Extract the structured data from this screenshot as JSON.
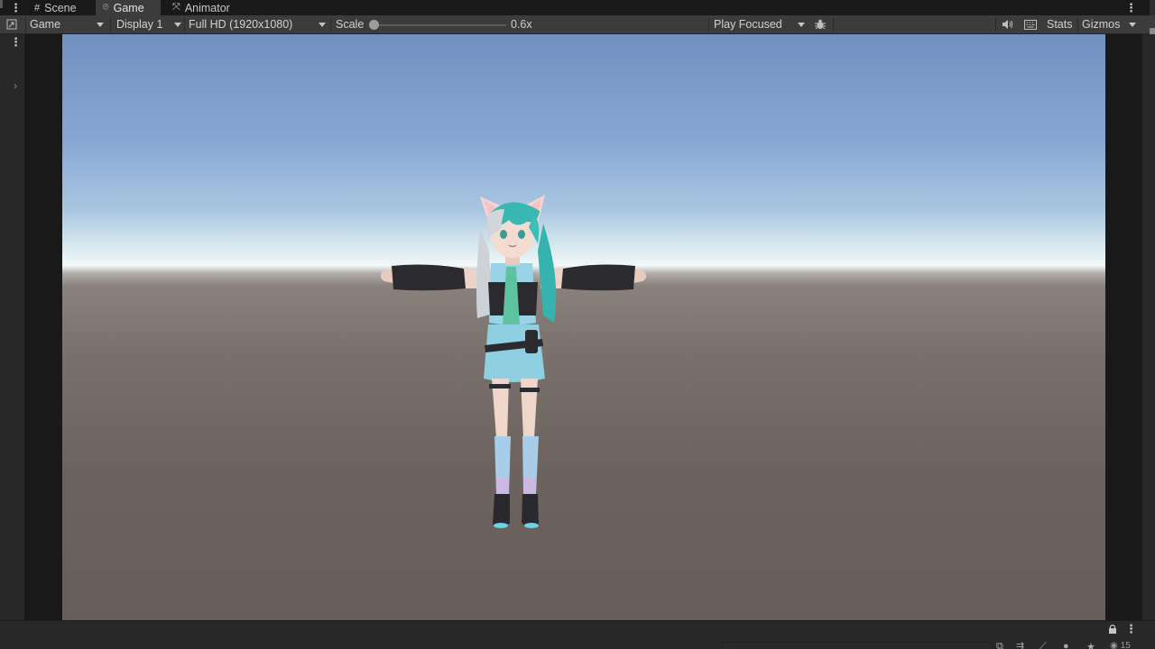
{
  "tabs": [
    {
      "label": "Scene",
      "icon": "scene-grid-icon",
      "glyph": "#"
    },
    {
      "label": "Game",
      "icon": "gamepad-icon",
      "glyph": "⌾"
    },
    {
      "label": "Animator",
      "icon": "animator-icon",
      "glyph": "⤧"
    }
  ],
  "toolbar": {
    "view_mode": "Game",
    "display": "Display 1",
    "resolution": "Full HD (1920x1080)",
    "scale_label": "Scale",
    "scale_value": "0.6x",
    "play_mode": "Play Focused",
    "stats": "Stats",
    "gizmos": "Gizmos"
  },
  "bottom": {
    "visibility_count": "15"
  },
  "colors": {
    "panel": "#3c3c3c",
    "background": "#191919",
    "sky_top": "#7090c0",
    "horizon": "#f2f7f7",
    "ground": "#6c625e"
  }
}
